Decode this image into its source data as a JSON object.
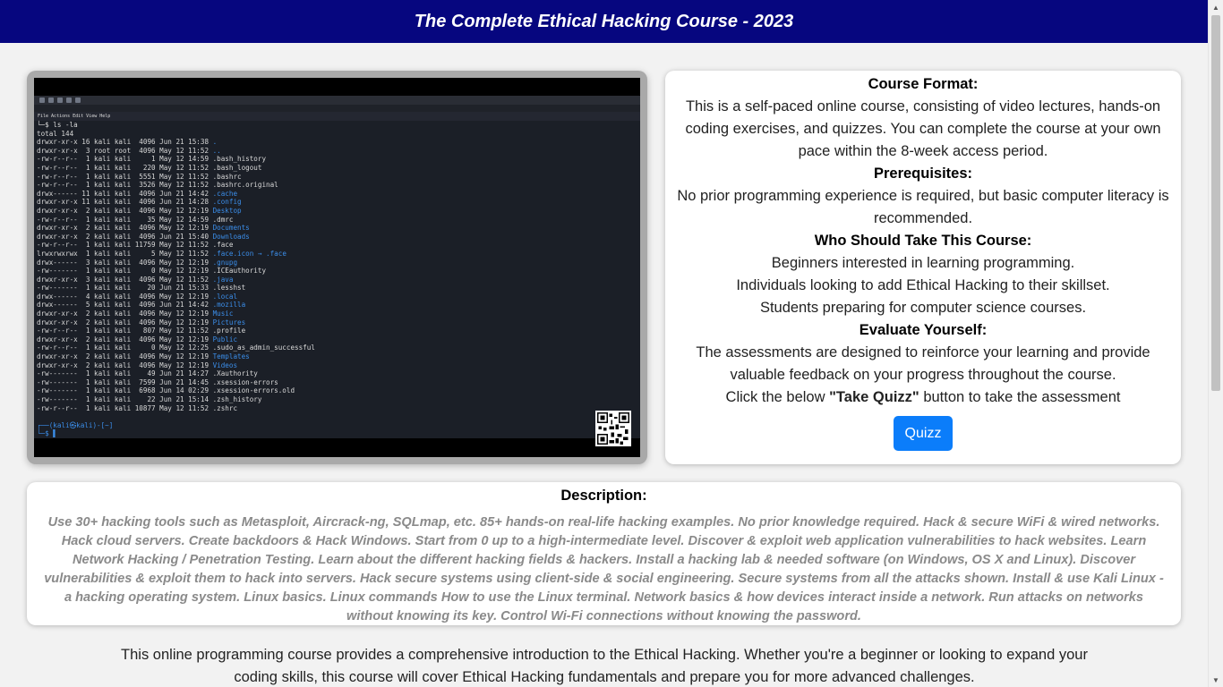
{
  "header": {
    "title": "The Complete Ethical Hacking Course - 2023"
  },
  "video": {
    "terminal_menu": "File  Actions  Edit  View  Help",
    "terminal_lines": [
      {
        "text": "└─$ ls -la",
        "dir": ""
      },
      {
        "text": "total 144",
        "dir": ""
      },
      {
        "text": "drwxr-xr-x 16 kali kali  4096 Jun 21 15:38 ",
        "dir": "."
      },
      {
        "text": "drwxr-xr-x  3 root root  4096 May 12 11:52 ",
        "dir": ".."
      },
      {
        "text": "-rw-r--r--  1 kali kali     1 May 12 14:59 .bash_history",
        "dir": ""
      },
      {
        "text": "-rw-r--r--  1 kali kali   220 May 12 11:52 .bash_logout",
        "dir": ""
      },
      {
        "text": "-rw-r--r--  1 kali kali  5551 May 12 11:52 .bashrc",
        "dir": ""
      },
      {
        "text": "-rw-r--r--  1 kali kali  3526 May 12 11:52 .bashrc.original",
        "dir": ""
      },
      {
        "text": "drwx------ 11 kali kali  4096 Jun 21 14:42 ",
        "dir": ".cache"
      },
      {
        "text": "drwxr-xr-x 11 kali kali  4096 Jun 21 14:28 ",
        "dir": ".config"
      },
      {
        "text": "drwxr-xr-x  2 kali kali  4096 May 12 12:19 ",
        "dir": "Desktop"
      },
      {
        "text": "-rw-r--r--  1 kali kali    35 May 12 14:59 .dmrc",
        "dir": ""
      },
      {
        "text": "drwxr-xr-x  2 kali kali  4096 May 12 12:19 ",
        "dir": "Documents"
      },
      {
        "text": "drwxr-xr-x  2 kali kali  4096 Jun 21 15:40 ",
        "dir": "Downloads"
      },
      {
        "text": "-rw-r--r--  1 kali kali 11759 May 12 11:52 .face",
        "dir": ""
      },
      {
        "text": "lrwxrwxrwx  1 kali kali     5 May 12 11:52 ",
        "dir": ".face.icon → .face"
      },
      {
        "text": "drwx------  3 kali kali  4096 May 12 12:19 ",
        "dir": ".gnupg"
      },
      {
        "text": "-rw-------  1 kali kali     0 May 12 12:19 .ICEauthority",
        "dir": ""
      },
      {
        "text": "drwxr-xr-x  3 kali kali  4096 May 12 11:52 ",
        "dir": ".java"
      },
      {
        "text": "-rw-------  1 kali kali    20 Jun 21 15:33 .lesshst",
        "dir": ""
      },
      {
        "text": "drwx------  4 kali kali  4096 May 12 12:19 ",
        "dir": ".local"
      },
      {
        "text": "drwx------  5 kali kali  4096 Jun 21 14:42 ",
        "dir": ".mozilla"
      },
      {
        "text": "drwxr-xr-x  2 kali kali  4096 May 12 12:19 ",
        "dir": "Music"
      },
      {
        "text": "drwxr-xr-x  2 kali kali  4096 May 12 12:19 ",
        "dir": "Pictures"
      },
      {
        "text": "-rw-r--r--  1 kali kali   807 May 12 11:52 .profile",
        "dir": ""
      },
      {
        "text": "drwxr-xr-x  2 kali kali  4096 May 12 12:19 ",
        "dir": "Public"
      },
      {
        "text": "-rw-r--r--  1 kali kali     0 May 12 12:25 .sudo_as_admin_successful",
        "dir": ""
      },
      {
        "text": "drwxr-xr-x  2 kali kali  4096 May 12 12:19 ",
        "dir": "Templates"
      },
      {
        "text": "drwxr-xr-x  2 kali kali  4096 May 12 12:19 ",
        "dir": "Videos"
      },
      {
        "text": "-rw-------  1 kali kali    49 Jun 21 14:27 .Xauthority",
        "dir": ""
      },
      {
        "text": "-rw-------  1 kali kali  7599 Jun 21 14:45 .xsession-errors",
        "dir": ""
      },
      {
        "text": "-rw-------  1 kali kali  6968 Jun 14 02:29 .xsession-errors.old",
        "dir": ""
      },
      {
        "text": "-rw-------  1 kali kali    22 Jun 21 15:14 .zsh_history",
        "dir": ""
      },
      {
        "text": "-rw-r--r--  1 kali kali 10877 May 12 11:52 .zshrc",
        "dir": ""
      }
    ],
    "prompt_line1": "┌──(kali㉿kali)-[~]",
    "prompt_line2": "└─$ ▌"
  },
  "course_info": {
    "format_heading": "Course Format:",
    "format_text": "This is a self-paced online course, consisting of video lectures, hands-on coding exercises, and quizzes. You can complete the course at your own pace within the 8-week access period.",
    "prereq_heading": "Prerequisites:",
    "prereq_text": "No prior programming experience is required, but basic computer literacy is recommended.",
    "who_heading": "Who Should Take This Course:",
    "who_items": [
      "Beginners interested in learning programming.",
      "Individuals looking to add Ethical Hacking to their skillset.",
      "Students preparing for computer science courses."
    ],
    "evaluate_heading": "Evaluate Yourself:",
    "evaluate_text": "The assessments are designed to reinforce your learning and provide valuable feedback on your progress throughout the course.",
    "click_prefix": "Click the below ",
    "click_bold": "\"Take Quizz\"",
    "click_suffix": " button to take the assessment",
    "quiz_button_label": "Quizz"
  },
  "description": {
    "heading": "Description:",
    "text": "Use 30+ hacking tools such as Metasploit, Aircrack-ng, SQLmap, etc. 85+ hands-on real-life hacking examples. No prior knowledge required. Hack & secure WiFi & wired networks. Hack cloud servers. Create backdoors & Hack Windows. Start from 0 up to a high-intermediate level. Discover & exploit web application vulnerabilities to hack websites. Learn Network Hacking / Penetration Testing. Learn about the different hacking fields & hackers. Install a hacking lab & needed software (on Windows, OS X and Linux). Discover vulnerabilities & exploit them to hack into servers. Hack secure systems using client-side & social engineering. Secure systems from all the attacks shown. Install & use Kali Linux - a hacking operating system. Linux basics. Linux commands How to use the Linux terminal. Network basics & how devices interact inside a network. Run attacks on networks without knowing its key. Control Wi-Fi connections without knowing the password."
  },
  "footer": {
    "text": "This online programming course provides a comprehensive introduction to the Ethical Hacking. Whether you're a beginner or looking to expand your coding skills, this course will cover Ethical Hacking fundamentals and prepare you for more advanced challenges."
  },
  "colors": {
    "header_bg": "#06067f",
    "button_bg": "#0b7dfa",
    "description_text": "#8a8a8a",
    "terminal_dir": "#3b8eea"
  }
}
